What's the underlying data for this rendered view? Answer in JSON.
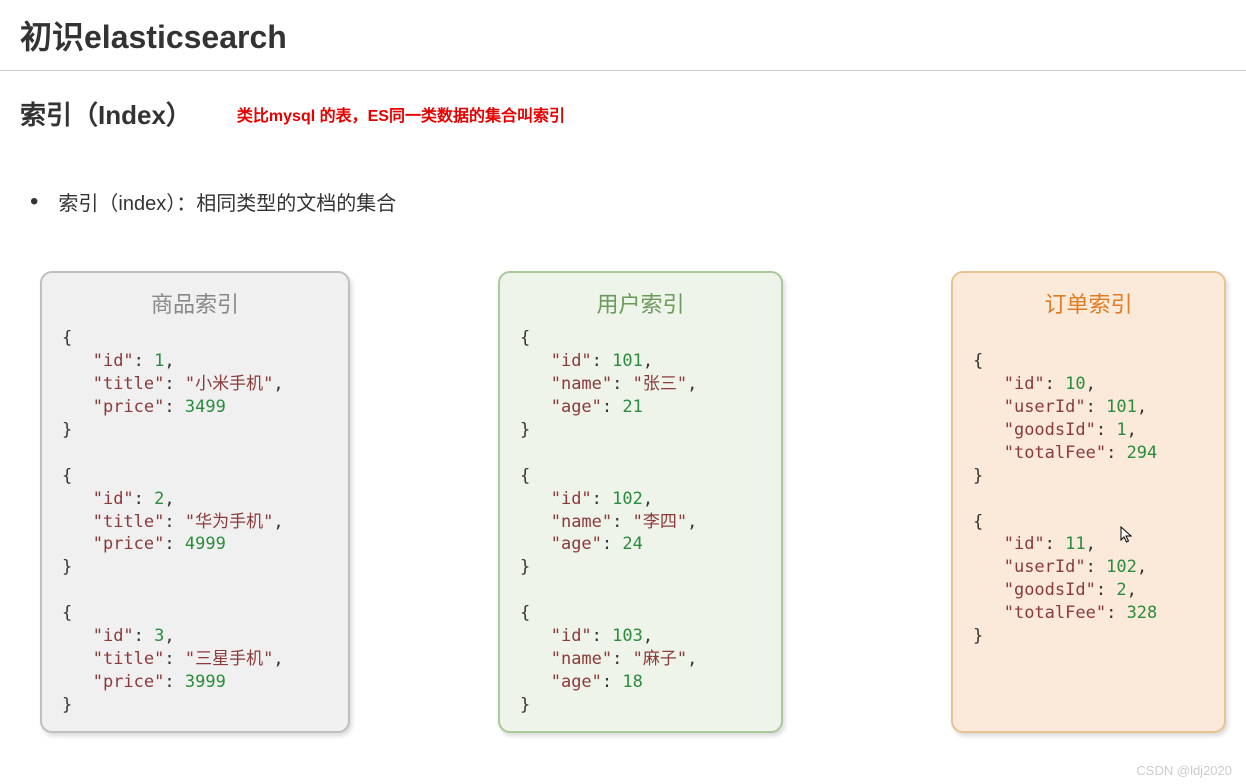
{
  "header": {
    "title": "初识elasticsearch"
  },
  "sub": {
    "title": "索引（Index）",
    "note": "类比mysql 的表，ES同一类数据的集合叫索引"
  },
  "bullet": {
    "text": "索引（index）：相同类型的文档的集合"
  },
  "cards": {
    "goods": {
      "title": "商品索引",
      "items": [
        {
          "id": 1,
          "title": "小米手机",
          "price": 3499
        },
        {
          "id": 2,
          "title": "华为手机",
          "price": 4999
        },
        {
          "id": 3,
          "title": "三星手机",
          "price": 3999
        }
      ]
    },
    "user": {
      "title": "用户索引",
      "items": [
        {
          "id": 101,
          "name": "张三",
          "age": 21
        },
        {
          "id": 102,
          "name": "李四",
          "age": 24
        },
        {
          "id": 103,
          "name": "麻子",
          "age": 18
        }
      ]
    },
    "order": {
      "title": "订单索引",
      "items": [
        {
          "id": 10,
          "userId": 101,
          "goodsId": 1,
          "totalFee": 294
        },
        {
          "id": 11,
          "userId": 102,
          "goodsId": 2,
          "totalFee": 328
        }
      ]
    }
  },
  "watermark": "CSDN @ldj2020"
}
